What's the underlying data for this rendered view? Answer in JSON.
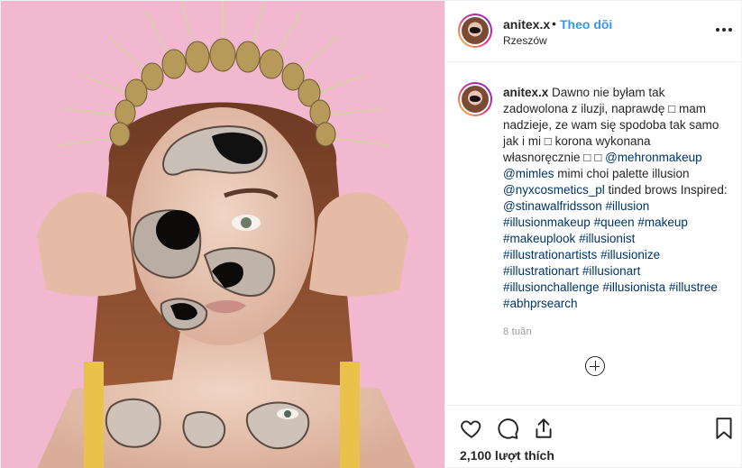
{
  "post": {
    "username": "anitex.x",
    "separator": "•",
    "follow_label": "Theo dõi",
    "location": "Rzeszów",
    "more_icon": "more-options-icon",
    "caption_parts": [
      {
        "type": "text",
        "text": "Dawno nie byłam tak zadowolona z iluzji, naprawdę □ mam nadzieje, ze wam się spodoba tak samo jak i mi □ korona wykonana własnoręcznie □ □ "
      },
      {
        "type": "link",
        "text": "@mehronmakeup"
      },
      {
        "type": "text",
        "text": " "
      },
      {
        "type": "link",
        "text": "@mimles"
      },
      {
        "type": "text",
        "text": " mimi choi palette illusion "
      },
      {
        "type": "link",
        "text": "@nyxcosmetics_pl"
      },
      {
        "type": "text",
        "text": " tinded brows Inspired: "
      },
      {
        "type": "link",
        "text": "@stinawalfridsson"
      },
      {
        "type": "text",
        "text": " "
      },
      {
        "type": "link",
        "text": "#illusion"
      },
      {
        "type": "text",
        "text": " "
      },
      {
        "type": "link",
        "text": "#illusionmakeup"
      },
      {
        "type": "text",
        "text": " "
      },
      {
        "type": "link",
        "text": "#queen"
      },
      {
        "type": "text",
        "text": " "
      },
      {
        "type": "link",
        "text": "#makeup"
      },
      {
        "type": "text",
        "text": " "
      },
      {
        "type": "link",
        "text": "#makeuplook"
      },
      {
        "type": "text",
        "text": " "
      },
      {
        "type": "link",
        "text": "#illusionist"
      },
      {
        "type": "text",
        "text": " "
      },
      {
        "type": "link",
        "text": "#illustrationartists"
      },
      {
        "type": "text",
        "text": " "
      },
      {
        "type": "link",
        "text": "#illusionize"
      },
      {
        "type": "text",
        "text": " "
      },
      {
        "type": "link",
        "text": "#illustrationart"
      },
      {
        "type": "text",
        "text": " "
      },
      {
        "type": "link",
        "text": "#illusionart"
      },
      {
        "type": "text",
        "text": " "
      },
      {
        "type": "link",
        "text": "#illusionchallenge"
      },
      {
        "type": "text",
        "text": " "
      },
      {
        "type": "link",
        "text": "#illusionista"
      },
      {
        "type": "text",
        "text": " "
      },
      {
        "type": "link",
        "text": "#illustree"
      },
      {
        "type": "text",
        "text": " "
      },
      {
        "type": "link",
        "text": "#abhprsearch"
      }
    ],
    "time_ago": "8 tuần",
    "load_more_icon": "plus-circle-icon",
    "likes": "2,100 lượt thích"
  },
  "actions": {
    "like_icon": "heart-icon",
    "comment_icon": "comment-icon",
    "share_icon": "share-icon",
    "save_icon": "bookmark-icon"
  },
  "colors": {
    "link": "#003569",
    "follow": "#3897f0",
    "background_pink": "#f2b3cc",
    "muted": "#999999"
  }
}
